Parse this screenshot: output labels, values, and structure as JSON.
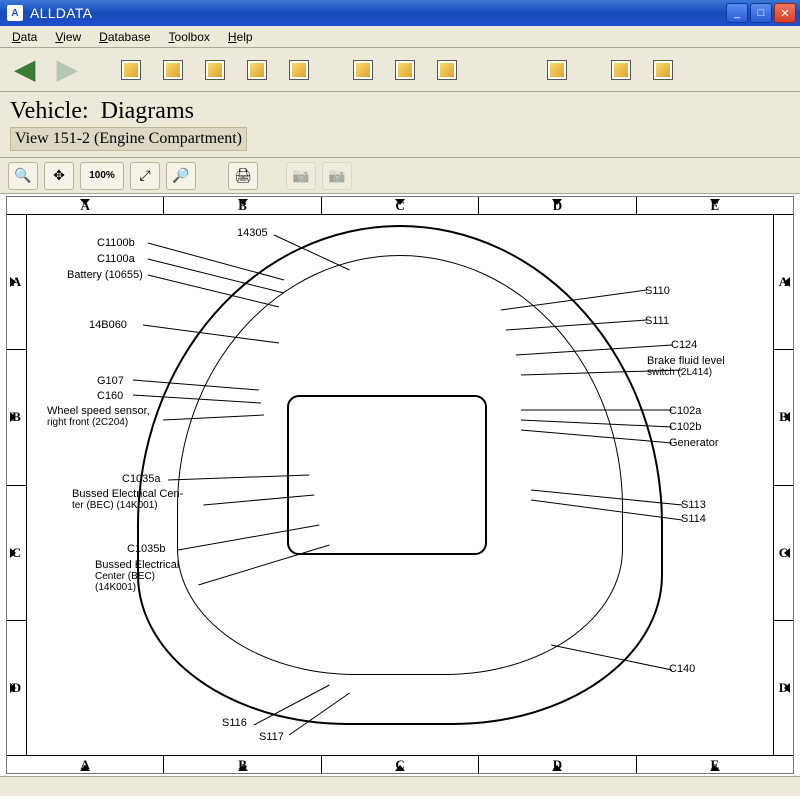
{
  "window": {
    "title": "ALLDATA"
  },
  "menubar": {
    "items": [
      "Data",
      "View",
      "Database",
      "Toolbox",
      "Help"
    ]
  },
  "header": {
    "vehicle_label": "Vehicle:",
    "section": "Diagrams",
    "view_line": "View 151-2 (Engine Compartment)"
  },
  "viewer_tools": {
    "fit_label": "100%"
  },
  "ruler": {
    "cols": [
      "A",
      "B",
      "C",
      "D",
      "E"
    ],
    "rows": [
      "A",
      "B",
      "C",
      "D"
    ]
  },
  "callouts_left": [
    {
      "id": "C1100b",
      "line1": "C1100b"
    },
    {
      "id": "C1100a",
      "line1": "C1100a"
    },
    {
      "id": "battery",
      "line1": "Battery (10655)"
    },
    {
      "id": "14305",
      "line1": "14305"
    },
    {
      "id": "14B060",
      "line1": "14B060"
    },
    {
      "id": "G107",
      "line1": "G107"
    },
    {
      "id": "C160",
      "line1": "C160"
    },
    {
      "id": "wheelspeed",
      "line1": "Wheel speed sensor,",
      "line2": "right front (2C204)"
    },
    {
      "id": "C1035a",
      "line1": "C1035a"
    },
    {
      "id": "bec1",
      "line1": "Bussed Electrical Cen-",
      "line2": "ter (BEC) (14K001)"
    },
    {
      "id": "C1035b",
      "line1": "C1035b"
    },
    {
      "id": "bec2",
      "line1": "Bussed Electrical",
      "line2": "Center (BEC)",
      "line3": "(14K001)"
    },
    {
      "id": "S116",
      "line1": "S116"
    },
    {
      "id": "S117",
      "line1": "S117"
    }
  ],
  "callouts_right": [
    {
      "id": "S110",
      "line1": "S110"
    },
    {
      "id": "S111",
      "line1": "S111"
    },
    {
      "id": "C124",
      "line1": "C124"
    },
    {
      "id": "brakefluid",
      "line1": "Brake fluid level",
      "line2": "switch (2L414)"
    },
    {
      "id": "C102a",
      "line1": "C102a"
    },
    {
      "id": "C102b",
      "line1": "C102b"
    },
    {
      "id": "generator",
      "line1": "Generator"
    },
    {
      "id": "S113",
      "line1": "S113"
    },
    {
      "id": "S114",
      "line1": "S114"
    },
    {
      "id": "C140",
      "line1": "C140"
    }
  ]
}
